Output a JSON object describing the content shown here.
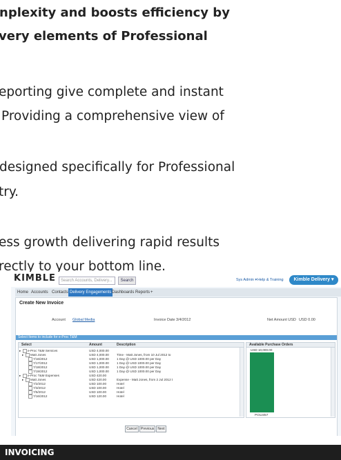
{
  "text": {
    "line1": "nplexity and boosts efficiency by",
    "line2": "very elements of Professional",
    "line3": "eporting give complete and instant",
    "line4": "Providing a comprehensive view of",
    "line5": "designed specifically for Professional",
    "line6": "try.",
    "line7": "ess growth delivering rapid results",
    "line8": "rectly to your bottom line."
  },
  "app": {
    "logo": "KIMBLE",
    "search_placeholder": "Search Accounts, Delivery...",
    "search_button": "Search",
    "user_menu": "Sys Admin ▾",
    "help_link": "Help & Training",
    "app_switcher": "Kimble Delivery ▾",
    "tabs": [
      "Home",
      "Accounts",
      "Contacts",
      "Delivery Engagements",
      "Dashboards",
      "Reports",
      "+"
    ],
    "active_tab": "Delivery Engagements"
  },
  "invoice": {
    "title": "Create New Invoice",
    "account_label": "Account",
    "account_value": "Global Media",
    "date_label": "Invoice Date",
    "date_value": "3/4/2012",
    "net_label": "Net Amount USD",
    "net_value": "USD 0.00",
    "section_label": "Select Items to include for e-Proc T&M",
    "columns": [
      "Select",
      "Amount",
      "Description"
    ],
    "rows": [
      {
        "select": "e-Proc T&M Services",
        "amount": "USD 4,000.00",
        "desc": ""
      },
      {
        "select": "Matt Jones",
        "amount": "USD 4,000.00",
        "desc": "Time - Matt Jones, from 10 Jul 2012 to"
      },
      {
        "select": "7/16/2012",
        "amount": "USD 1,000.00",
        "desc": "1 Day @ USD 1000.00 per Day"
      },
      {
        "select": "7/17/2012",
        "amount": "USD 1,000.00",
        "desc": "1 Day @ USD 1000.00 per Day"
      },
      {
        "select": "7/18/2012",
        "amount": "USD 1,000.00",
        "desc": "1 Day @ USD 1000.00 per Day"
      },
      {
        "select": "7/19/2012",
        "amount": "USD 1,000.00",
        "desc": "1 Day @ USD 1000.00 per Day"
      },
      {
        "select": "e-Proc T&M Expenses",
        "amount": "USD 420.00",
        "desc": ""
      },
      {
        "select": "Matt Jones",
        "amount": "USD 420.00",
        "desc": "Expense - Matt Jones, from 2 Jul 2012 t"
      },
      {
        "select": "7/2/2012",
        "amount": "USD 100.00",
        "desc": "Hotel"
      },
      {
        "select": "7/3/2012",
        "amount": "USD 100.00",
        "desc": "Hotel"
      },
      {
        "select": "7/5/2012",
        "amount": "USD 100.00",
        "desc": "Hotel"
      },
      {
        "select": "7/16/2012",
        "amount": "USD 120.00",
        "desc": "Hotel"
      }
    ],
    "po_header": "Available Purchase Orders",
    "po_amount": "USD 10,000.00",
    "po_number": "PO12457",
    "po_color": "#1b8f53",
    "buttons": {
      "cancel": "Cancel",
      "previous": "Previous",
      "next": "Next"
    }
  },
  "caption": "INVOICING"
}
